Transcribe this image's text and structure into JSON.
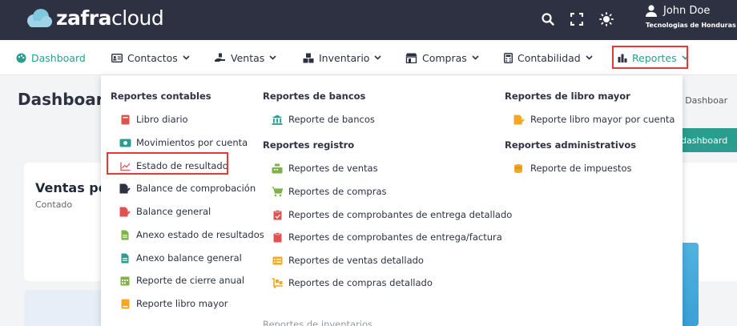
{
  "app": {
    "brand_bold": "zafra",
    "brand_light": "cloud",
    "user_name": "John Doe",
    "user_org": "Tecnologias de Honduras"
  },
  "nav": {
    "items": [
      {
        "label": "Dashboard",
        "icon": "palette-icon"
      },
      {
        "label": "Contactos",
        "icon": "contact-card-icon"
      },
      {
        "label": "Ventas",
        "icon": "hand-holding-icon"
      },
      {
        "label": "Inventario",
        "icon": "boxes-icon"
      },
      {
        "label": "Compras",
        "icon": "store-icon"
      },
      {
        "label": "Contabilidad",
        "icon": "calculator-icon"
      },
      {
        "label": "Reportes",
        "icon": "bar-chart-icon"
      }
    ]
  },
  "page": {
    "title": "Dashboard",
    "breadcrumb": "/ Dashboar",
    "dashboard_button": "dashboard",
    "card_title": "Ventas po",
    "card_subtitle": "Contado"
  },
  "reports": {
    "contables": {
      "heading": "Reportes contables",
      "items": [
        "Libro diario",
        "Movimientos por cuenta",
        "Estado de resultado",
        "Balance de comprobación",
        "Balance general",
        "Anexo estado de resultados",
        "Anexo balance general",
        "Reporte de cierre anual",
        "Reporte libro mayor"
      ]
    },
    "bancos": {
      "heading": "Reportes de bancos",
      "items": [
        "Reporte de bancos"
      ]
    },
    "registro": {
      "heading": "Reportes registro",
      "items": [
        "Reportes de ventas",
        "Reportes de compras",
        "Reportes de comprobantes de entrega detallado",
        "Reportes de comprobantes de entrega/factura",
        "Reportes de ventas detallado",
        "Reportes de compras detallado"
      ]
    },
    "mayor": {
      "heading": "Reportes de libro mayor",
      "items": [
        "Reporte libro mayor por cuenta"
      ]
    },
    "administrativos": {
      "heading": "Reportes administrativos",
      "items": [
        "Reporte de impuestos"
      ]
    },
    "faded_text": "Reportes de inventarios"
  }
}
